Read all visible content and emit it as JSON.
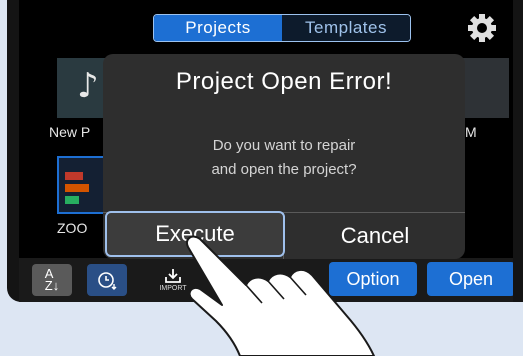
{
  "header": {
    "tabs": [
      {
        "label": "Projects",
        "active": true
      },
      {
        "label": "Templates",
        "active": false
      }
    ],
    "settings_icon": "gear-icon"
  },
  "projects": {
    "items": [
      {
        "label": "New P"
      },
      {
        "label": "M"
      },
      {
        "label": "ZOO"
      }
    ]
  },
  "dialog": {
    "title": "Project Open Error!",
    "message_line1": "Do you want to repair",
    "message_line2": "and open the project?",
    "execute_label": "Execute",
    "cancel_label": "Cancel"
  },
  "toolbar": {
    "sort_name_icon": "sort-az-icon",
    "sort_date_icon": "clock-sort-icon",
    "import_label": "IMPORT",
    "option_label": "Option",
    "open_label": "Open"
  },
  "colors": {
    "accent": "#1d6fd3",
    "highlight": "#9fc0ec",
    "dialog_bg": "#2e2e2e"
  }
}
